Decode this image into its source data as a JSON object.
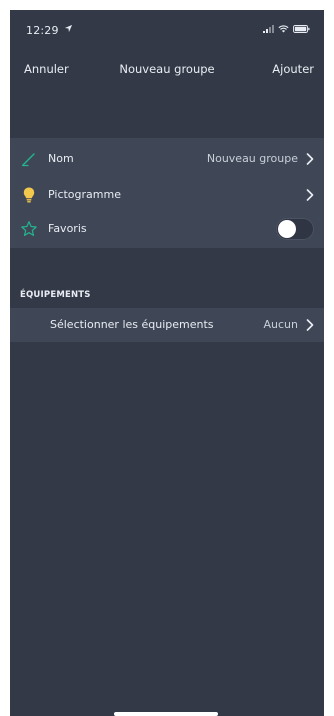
{
  "status_bar": {
    "time": "12:29",
    "icons": [
      "location-arrow-icon",
      "signal-icon",
      "wifi-icon",
      "battery-icon"
    ]
  },
  "nav": {
    "cancel_label": "Annuler",
    "title": "Nouveau groupe",
    "add_label": "Ajouter"
  },
  "settings": {
    "name": {
      "label": "Nom",
      "value": "Nouveau groupe",
      "icon": "pencil-icon"
    },
    "pictogram": {
      "label": "Pictogramme",
      "icon": "lightbulb-icon"
    },
    "favorite": {
      "label": "Favoris",
      "icon": "star-icon",
      "toggle_on": false
    }
  },
  "equipment": {
    "section_header": "ÉQUIPEMENTS",
    "select_label": "Sélectionner les équipements",
    "select_value": "Aucun"
  },
  "colors": {
    "background": "#333947",
    "row_background": "#3f4656",
    "accent_green": "#23b58f",
    "bulb_yellow": "#f2c94c",
    "text": "#e9edf3"
  }
}
